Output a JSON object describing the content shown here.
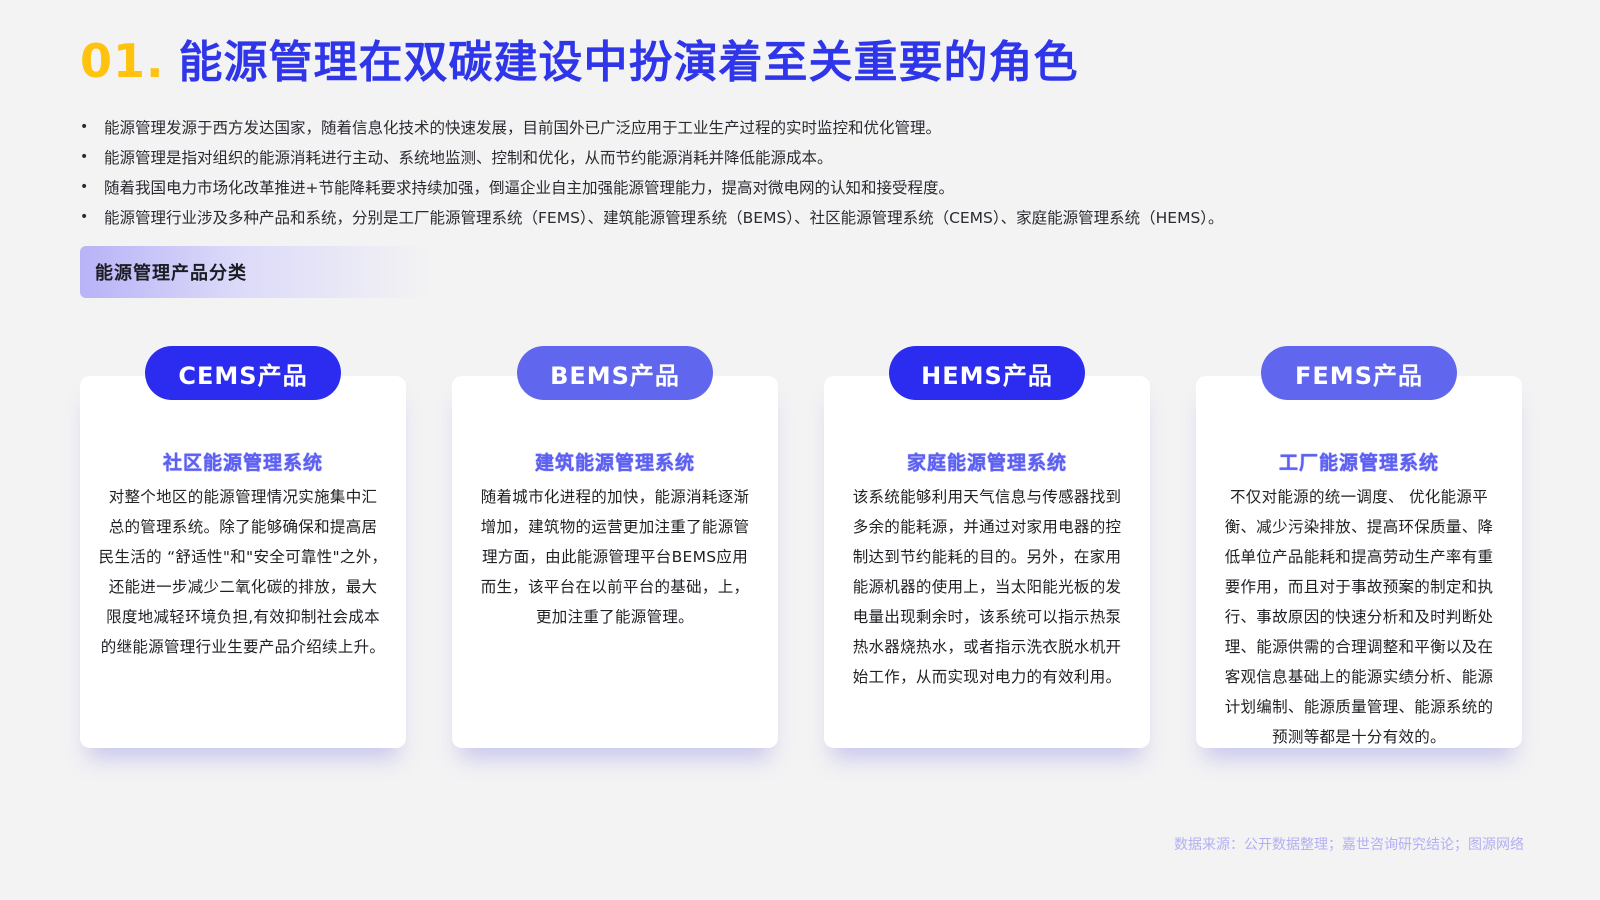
{
  "title": {
    "number": "01.",
    "text": "能源管理在双碳建设中扮演着至关重要的角色"
  },
  "bullets": [
    "能源管理发源于西方发达国家，随着信息化技术的快速发展，目前国外已广泛应用于工业生产过程的实时监控和优化管理。",
    "能源管理是指对组织的能源消耗进行主动、系统地监测、控制和优化，从而节约能源消耗并降低能源成本。",
    "随着我国电力市场化改革推进+节能降耗要求持续加强，倒逼企业自主加强能源管理能力，提高对微电网的认知和接受程度。",
    "能源管理行业涉及多种产品和系统，分别是工厂能源管理系统（FEMS）、建筑能源管理系统（BEMS）、社区能源管理系统（CEMS）、家庭能源管理系统（HEMS）。"
  ],
  "bullet_marker": "•",
  "section": {
    "label": "能源管理产品分类"
  },
  "cards": [
    {
      "pill": "CEMS产品",
      "subtitle": "社区能源管理系统",
      "lines": [
        "对整个地区的能源管理情况实施集中汇",
        "总的管理系统。除了能够确保和提高居",
        "民生活的 “舒适性\"和\"安全可靠性\"之外，",
        "还能进一步减少二氧化碳的排放，最大",
        "限度地减轻环境负担,有效抑制社会成本",
        "的继能源管理行业生要产品介绍续上升。"
      ]
    },
    {
      "pill": "BEMS产品",
      "subtitle": "建筑能源管理系统",
      "lines": [
        "随着城市化进程的加快，能源消耗逐渐",
        "增加，建筑物的运营更加注重了能源管",
        "理方面，由此能源管理平台BEMS应用",
        "而生，该平台在以前平台的基础，上，",
        "更加注重了能源管理。"
      ]
    },
    {
      "pill": "HEMS产品",
      "subtitle": "家庭能源管理系统",
      "lines": [
        "该系统能够利用天气信息与传感器找到",
        "多余的能耗源，并通过对家用电器的控",
        "制达到节约能耗的目的。另外，在家用",
        "能源机器的使用上，当太阳能光板的发",
        "电量出现剩余时，该系统可以指示热泵",
        "热水器烧热水，或者指示洗衣脱水机开",
        "始工作，从而实现对电力的有效利用。"
      ]
    },
    {
      "pill": "FEMS产品",
      "subtitle": "工厂能源管理系统",
      "lines": [
        "不仅对能源的统一调度、 优化能源平",
        "衡、减少污染排放、提高环保质量、降",
        "低单位产品能耗和提高劳动生产率有重",
        "要作用，而且对于事故预案的制定和执",
        "行、事故原因的快速分析和及时判断处",
        "理、能源供需的合理调整和平衡以及在",
        "客观信息基础上的能源实绩分析、能源",
        "计划编制、能源质量管理、能源系统的",
        "预测等都是十分有效的。"
      ]
    }
  ],
  "source": "数据来源：公开数据整理；嘉世咨询研究结论；图源网络",
  "colors": {
    "accent_yellow": "#ffc20e",
    "accent_blue": "#2f35e8",
    "pill_dark": "#2b2cf0",
    "pill_light": "#6166ee",
    "subtitle_blue": "#5d60f2",
    "source_text": "#b2b0f3",
    "background": "#f3f3f4"
  }
}
